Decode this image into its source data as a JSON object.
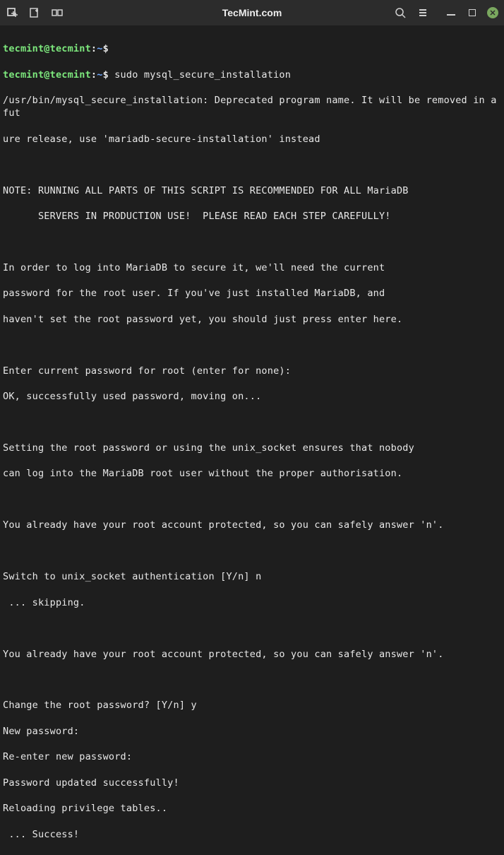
{
  "titlebar": {
    "title": "TecMint.com"
  },
  "prompt": {
    "user_host": "tecmint@tecmint",
    "separator": ":",
    "path": "~",
    "symbol": "$"
  },
  "command": "sudo mysql_secure_installation",
  "output": {
    "l1": "/usr/bin/mysql_secure_installation: Deprecated program name. It will be removed in a fut",
    "l2": "ure release, use 'mariadb-secure-installation' instead",
    "l3": "",
    "l4": "NOTE: RUNNING ALL PARTS OF THIS SCRIPT IS RECOMMENDED FOR ALL MariaDB",
    "l5": "      SERVERS IN PRODUCTION USE!  PLEASE READ EACH STEP CAREFULLY!",
    "l6": "",
    "l7": "In order to log into MariaDB to secure it, we'll need the current",
    "l8": "password for the root user. If you've just installed MariaDB, and",
    "l9": "haven't set the root password yet, you should just press enter here.",
    "l10": "",
    "l11": "Enter current password for root (enter for none):",
    "l12": "OK, successfully used password, moving on...",
    "l13": "",
    "l14": "Setting the root password or using the unix_socket ensures that nobody",
    "l15": "can log into the MariaDB root user without the proper authorisation.",
    "l16": "",
    "l17": "You already have your root account protected, so you can safely answer 'n'.",
    "l18": "",
    "l19": "Switch to unix_socket authentication [Y/n] n",
    "l20": " ... skipping.",
    "l21": "",
    "l22": "You already have your root account protected, so you can safely answer 'n'.",
    "l23": "",
    "l24": "Change the root password? [Y/n] y",
    "l25": "New password:",
    "l26": "Re-enter new password:",
    "l27": "Password updated successfully!",
    "l28": "Reloading privilege tables..",
    "l29": " ... Success!"
  }
}
